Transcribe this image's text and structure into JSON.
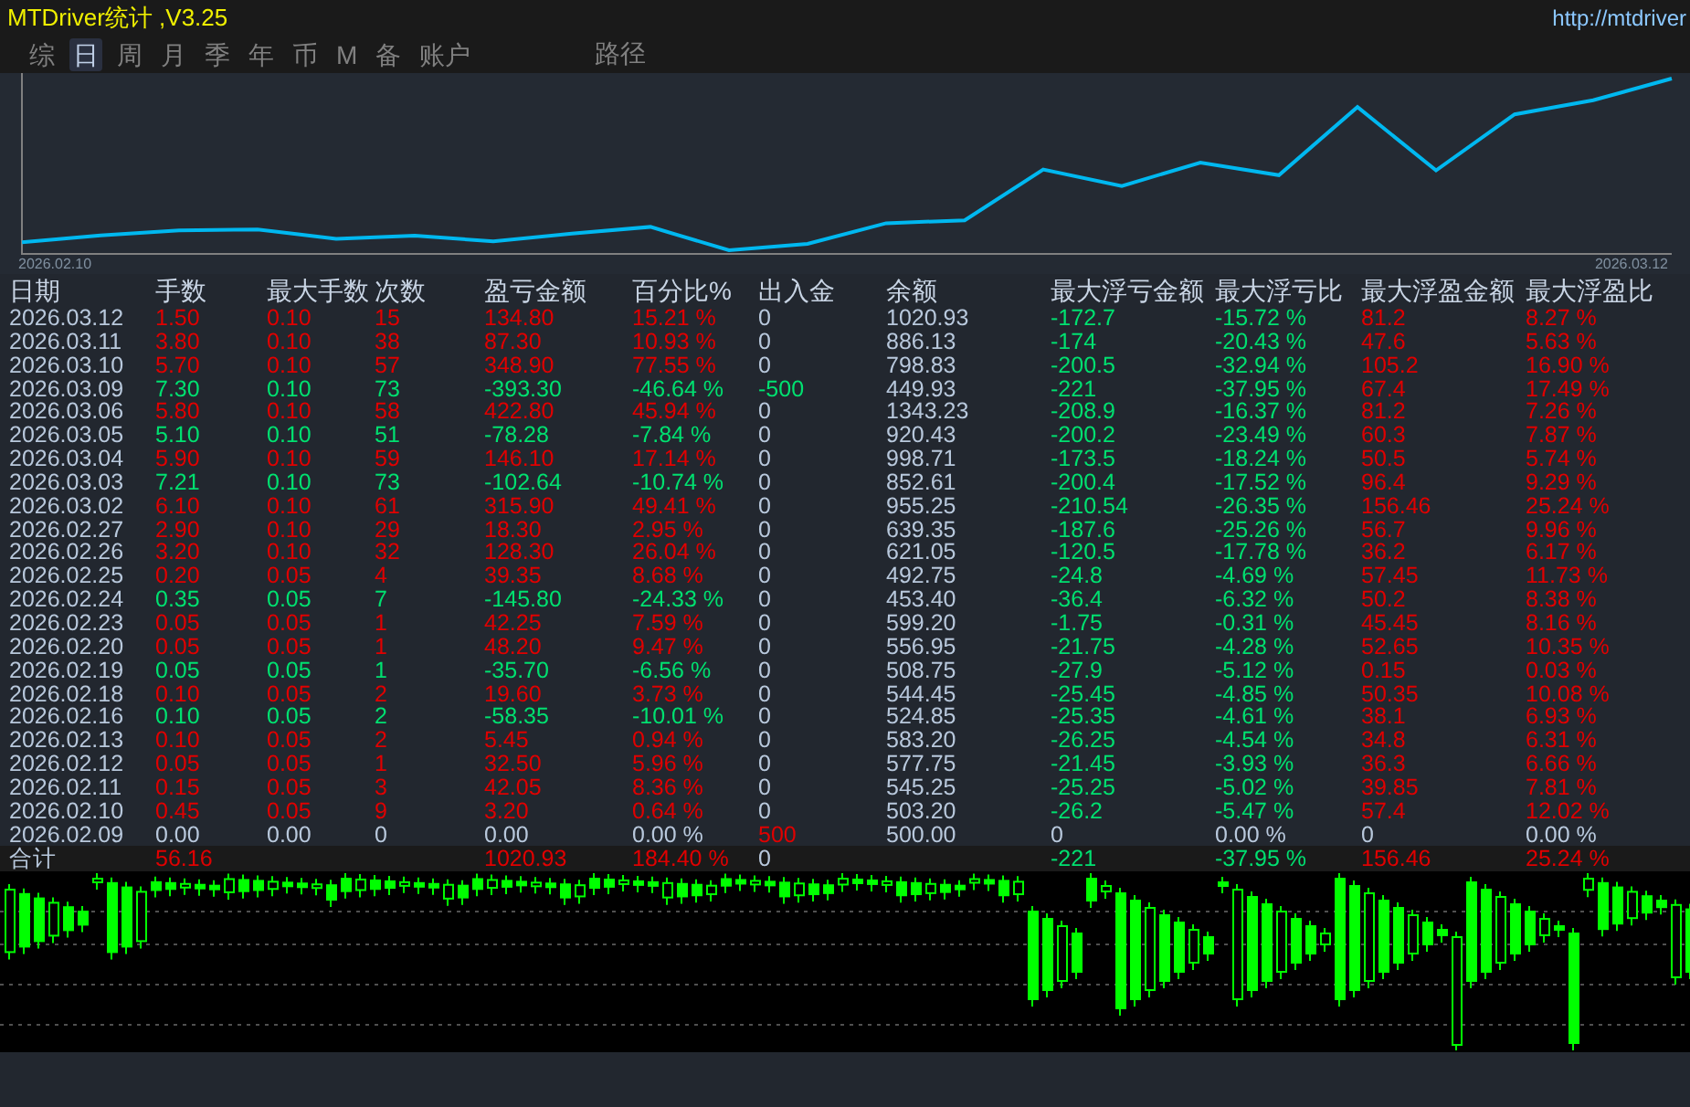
{
  "window": {
    "title": "MTDriver统计 ,V3.25",
    "link": "http://mtdriver"
  },
  "tabs": [
    {
      "label": "综",
      "selected": false
    },
    {
      "label": "日",
      "selected": true
    },
    {
      "label": "周",
      "selected": false
    },
    {
      "label": "月",
      "selected": false
    },
    {
      "label": "季",
      "selected": false
    },
    {
      "label": "年",
      "selected": false
    },
    {
      "label": "币",
      "selected": false
    },
    {
      "label": "M",
      "selected": false
    },
    {
      "label": "备",
      "selected": false
    },
    {
      "label": "账户",
      "selected": false
    }
  ],
  "tools": [
    {
      "label": "路径"
    }
  ],
  "balance_chart": {
    "start_label": "2026.02.10",
    "end_label": "2026.03.12"
  },
  "table": {
    "columns": [
      "日期",
      "手数",
      "最大手数",
      "次数",
      "盈亏金额",
      "百分比%",
      "出入金",
      "余额",
      "最大浮亏金额",
      "最大浮亏比",
      "最大浮盈金额",
      "最大浮盈比"
    ],
    "rows": [
      {
        "date": "2026.03.12",
        "trade": {
          "color": "#e00000",
          "lots": "1.50",
          "max_lots": "0.10",
          "count": "15",
          "pnl": "134.80",
          "pct": "15.21 %"
        },
        "flow": {
          "color": "#b8c8dc",
          "text": "0"
        },
        "balance": "1020.93",
        "float_loss": {
          "color": "#00e070",
          "amount": "-172.7",
          "pct": "-15.72 %"
        },
        "float_profit": {
          "color": "#e00000",
          "amount": "81.2",
          "pct": "8.27 %"
        }
      },
      {
        "date": "2026.03.11",
        "trade": {
          "color": "#e00000",
          "lots": "3.80",
          "max_lots": "0.10",
          "count": "38",
          "pnl": "87.30",
          "pct": "10.93 %"
        },
        "flow": {
          "color": "#b8c8dc",
          "text": "0"
        },
        "balance": "886.13",
        "float_loss": {
          "color": "#00e070",
          "amount": "-174",
          "pct": "-20.43 %"
        },
        "float_profit": {
          "color": "#e00000",
          "amount": "47.6",
          "pct": "5.63 %"
        }
      },
      {
        "date": "2026.03.10",
        "trade": {
          "color": "#e00000",
          "lots": "5.70",
          "max_lots": "0.10",
          "count": "57",
          "pnl": "348.90",
          "pct": "77.55 %"
        },
        "flow": {
          "color": "#b8c8dc",
          "text": "0"
        },
        "balance": "798.83",
        "float_loss": {
          "color": "#00e070",
          "amount": "-200.5",
          "pct": "-32.94 %"
        },
        "float_profit": {
          "color": "#e00000",
          "amount": "105.2",
          "pct": "16.90 %"
        }
      },
      {
        "date": "2026.03.09",
        "trade": {
          "color": "#00e070",
          "lots": "7.30",
          "max_lots": "0.10",
          "count": "73",
          "pnl": "-393.30",
          "pct": "-46.64 %"
        },
        "flow": {
          "color": "#00e070",
          "text": "-500"
        },
        "balance": "449.93",
        "float_loss": {
          "color": "#00e070",
          "amount": "-221",
          "pct": "-37.95 %"
        },
        "float_profit": {
          "color": "#e00000",
          "amount": "67.4",
          "pct": "17.49 %"
        }
      },
      {
        "date": "2026.03.06",
        "trade": {
          "color": "#e00000",
          "lots": "5.80",
          "max_lots": "0.10",
          "count": "58",
          "pnl": "422.80",
          "pct": "45.94 %"
        },
        "flow": {
          "color": "#b8c8dc",
          "text": "0"
        },
        "balance": "1343.23",
        "float_loss": {
          "color": "#00e070",
          "amount": "-208.9",
          "pct": "-16.37 %"
        },
        "float_profit": {
          "color": "#e00000",
          "amount": "81.2",
          "pct": "7.26 %"
        }
      },
      {
        "date": "2026.03.05",
        "trade": {
          "color": "#00e070",
          "lots": "5.10",
          "max_lots": "0.10",
          "count": "51",
          "pnl": "-78.28",
          "pct": "-7.84 %"
        },
        "flow": {
          "color": "#b8c8dc",
          "text": "0"
        },
        "balance": "920.43",
        "float_loss": {
          "color": "#00e070",
          "amount": "-200.2",
          "pct": "-23.49 %"
        },
        "float_profit": {
          "color": "#e00000",
          "amount": "60.3",
          "pct": "7.87 %"
        }
      },
      {
        "date": "2026.03.04",
        "trade": {
          "color": "#e00000",
          "lots": "5.90",
          "max_lots": "0.10",
          "count": "59",
          "pnl": "146.10",
          "pct": "17.14 %"
        },
        "flow": {
          "color": "#b8c8dc",
          "text": "0"
        },
        "balance": "998.71",
        "float_loss": {
          "color": "#00e070",
          "amount": "-173.5",
          "pct": "-18.24 %"
        },
        "float_profit": {
          "color": "#e00000",
          "amount": "50.5",
          "pct": "5.74 %"
        }
      },
      {
        "date": "2026.03.03",
        "trade": {
          "color": "#00e070",
          "lots": "7.21",
          "max_lots": "0.10",
          "count": "73",
          "pnl": "-102.64",
          "pct": "-10.74 %"
        },
        "flow": {
          "color": "#b8c8dc",
          "text": "0"
        },
        "balance": "852.61",
        "float_loss": {
          "color": "#00e070",
          "amount": "-200.4",
          "pct": "-17.52 %"
        },
        "float_profit": {
          "color": "#e00000",
          "amount": "96.4",
          "pct": "9.29 %"
        }
      },
      {
        "date": "2026.03.02",
        "trade": {
          "color": "#e00000",
          "lots": "6.10",
          "max_lots": "0.10",
          "count": "61",
          "pnl": "315.90",
          "pct": "49.41 %"
        },
        "flow": {
          "color": "#b8c8dc",
          "text": "0"
        },
        "balance": "955.25",
        "float_loss": {
          "color": "#00e070",
          "amount": "-210.54",
          "pct": "-26.35 %"
        },
        "float_profit": {
          "color": "#e00000",
          "amount": "156.46",
          "pct": "25.24 %"
        }
      },
      {
        "date": "2026.02.27",
        "trade": {
          "color": "#e00000",
          "lots": "2.90",
          "max_lots": "0.10",
          "count": "29",
          "pnl": "18.30",
          "pct": "2.95 %"
        },
        "flow": {
          "color": "#b8c8dc",
          "text": "0"
        },
        "balance": "639.35",
        "float_loss": {
          "color": "#00e070",
          "amount": "-187.6",
          "pct": "-25.26 %"
        },
        "float_profit": {
          "color": "#e00000",
          "amount": "56.7",
          "pct": "9.96 %"
        }
      },
      {
        "date": "2026.02.26",
        "trade": {
          "color": "#e00000",
          "lots": "3.20",
          "max_lots": "0.10",
          "count": "32",
          "pnl": "128.30",
          "pct": "26.04 %"
        },
        "flow": {
          "color": "#b8c8dc",
          "text": "0"
        },
        "balance": "621.05",
        "float_loss": {
          "color": "#00e070",
          "amount": "-120.5",
          "pct": "-17.78 %"
        },
        "float_profit": {
          "color": "#e00000",
          "amount": "36.2",
          "pct": "6.17 %"
        }
      },
      {
        "date": "2026.02.25",
        "trade": {
          "color": "#e00000",
          "lots": "0.20",
          "max_lots": "0.05",
          "count": "4",
          "pnl": "39.35",
          "pct": "8.68 %"
        },
        "flow": {
          "color": "#b8c8dc",
          "text": "0"
        },
        "balance": "492.75",
        "float_loss": {
          "color": "#00e070",
          "amount": "-24.8",
          "pct": "-4.69 %"
        },
        "float_profit": {
          "color": "#e00000",
          "amount": "57.45",
          "pct": "11.73 %"
        }
      },
      {
        "date": "2026.02.24",
        "trade": {
          "color": "#00e070",
          "lots": "0.35",
          "max_lots": "0.05",
          "count": "7",
          "pnl": "-145.80",
          "pct": "-24.33 %"
        },
        "flow": {
          "color": "#b8c8dc",
          "text": "0"
        },
        "balance": "453.40",
        "float_loss": {
          "color": "#00e070",
          "amount": "-36.4",
          "pct": "-6.32 %"
        },
        "float_profit": {
          "color": "#e00000",
          "amount": "50.2",
          "pct": "8.38 %"
        }
      },
      {
        "date": "2026.02.23",
        "trade": {
          "color": "#e00000",
          "lots": "0.05",
          "max_lots": "0.05",
          "count": "1",
          "pnl": "42.25",
          "pct": "7.59 %"
        },
        "flow": {
          "color": "#b8c8dc",
          "text": "0"
        },
        "balance": "599.20",
        "float_loss": {
          "color": "#00e070",
          "amount": "-1.75",
          "pct": "-0.31 %"
        },
        "float_profit": {
          "color": "#e00000",
          "amount": "45.45",
          "pct": "8.16 %"
        }
      },
      {
        "date": "2026.02.20",
        "trade": {
          "color": "#e00000",
          "lots": "0.05",
          "max_lots": "0.05",
          "count": "1",
          "pnl": "48.20",
          "pct": "9.47 %"
        },
        "flow": {
          "color": "#b8c8dc",
          "text": "0"
        },
        "balance": "556.95",
        "float_loss": {
          "color": "#00e070",
          "amount": "-21.75",
          "pct": "-4.28 %"
        },
        "float_profit": {
          "color": "#e00000",
          "amount": "52.65",
          "pct": "10.35 %"
        }
      },
      {
        "date": "2026.02.19",
        "trade": {
          "color": "#00e070",
          "lots": "0.05",
          "max_lots": "0.05",
          "count": "1",
          "pnl": "-35.70",
          "pct": "-6.56 %"
        },
        "flow": {
          "color": "#b8c8dc",
          "text": "0"
        },
        "balance": "508.75",
        "float_loss": {
          "color": "#00e070",
          "amount": "-27.9",
          "pct": "-5.12 %"
        },
        "float_profit": {
          "color": "#e00000",
          "amount": "0.15",
          "pct": "0.03 %"
        }
      },
      {
        "date": "2026.02.18",
        "trade": {
          "color": "#e00000",
          "lots": "0.10",
          "max_lots": "0.05",
          "count": "2",
          "pnl": "19.60",
          "pct": "3.73 %"
        },
        "flow": {
          "color": "#b8c8dc",
          "text": "0"
        },
        "balance": "544.45",
        "float_loss": {
          "color": "#00e070",
          "amount": "-25.45",
          "pct": "-4.85 %"
        },
        "float_profit": {
          "color": "#e00000",
          "amount": "50.35",
          "pct": "10.08 %"
        }
      },
      {
        "date": "2026.02.16",
        "trade": {
          "color": "#00e070",
          "lots": "0.10",
          "max_lots": "0.05",
          "count": "2",
          "pnl": "-58.35",
          "pct": "-10.01 %"
        },
        "flow": {
          "color": "#b8c8dc",
          "text": "0"
        },
        "balance": "524.85",
        "float_loss": {
          "color": "#00e070",
          "amount": "-25.35",
          "pct": "-4.61 %"
        },
        "float_profit": {
          "color": "#e00000",
          "amount": "38.1",
          "pct": "6.93 %"
        }
      },
      {
        "date": "2026.02.13",
        "trade": {
          "color": "#e00000",
          "lots": "0.10",
          "max_lots": "0.05",
          "count": "2",
          "pnl": "5.45",
          "pct": "0.94 %"
        },
        "flow": {
          "color": "#b8c8dc",
          "text": "0"
        },
        "balance": "583.20",
        "float_loss": {
          "color": "#00e070",
          "amount": "-26.25",
          "pct": "-4.54 %"
        },
        "float_profit": {
          "color": "#e00000",
          "amount": "34.8",
          "pct": "6.31 %"
        }
      },
      {
        "date": "2026.02.12",
        "trade": {
          "color": "#e00000",
          "lots": "0.05",
          "max_lots": "0.05",
          "count": "1",
          "pnl": "32.50",
          "pct": "5.96 %"
        },
        "flow": {
          "color": "#b8c8dc",
          "text": "0"
        },
        "balance": "577.75",
        "float_loss": {
          "color": "#00e070",
          "amount": "-21.45",
          "pct": "-3.93 %"
        },
        "float_profit": {
          "color": "#e00000",
          "amount": "36.3",
          "pct": "6.66 %"
        }
      },
      {
        "date": "2026.02.11",
        "trade": {
          "color": "#e00000",
          "lots": "0.15",
          "max_lots": "0.05",
          "count": "3",
          "pnl": "42.05",
          "pct": "8.36 %"
        },
        "flow": {
          "color": "#b8c8dc",
          "text": "0"
        },
        "balance": "545.25",
        "float_loss": {
          "color": "#00e070",
          "amount": "-25.25",
          "pct": "-5.02 %"
        },
        "float_profit": {
          "color": "#e00000",
          "amount": "39.85",
          "pct": "7.81 %"
        }
      },
      {
        "date": "2026.02.10",
        "trade": {
          "color": "#e00000",
          "lots": "0.45",
          "max_lots": "0.05",
          "count": "9",
          "pnl": "3.20",
          "pct": "0.64 %"
        },
        "flow": {
          "color": "#b8c8dc",
          "text": "0"
        },
        "balance": "503.20",
        "float_loss": {
          "color": "#00e070",
          "amount": "-26.2",
          "pct": "-5.47 %"
        },
        "float_profit": {
          "color": "#e00000",
          "amount": "57.4",
          "pct": "12.02 %"
        }
      },
      {
        "date": "2026.02.09",
        "trade": {
          "color": "#b8c8dc",
          "lots": "0.00",
          "max_lots": "0.00",
          "count": "0",
          "pnl": "0.00",
          "pct": "0.00 %"
        },
        "flow": {
          "color": "#e00000",
          "text": "500"
        },
        "balance": "500.00",
        "float_loss": {
          "color": "#b8c8dc",
          "amount": "0",
          "pct": "0.00 %"
        },
        "float_profit": {
          "color": "#b8c8dc",
          "amount": "0",
          "pct": "0.00 %"
        }
      }
    ],
    "total": {
      "label": "合计",
      "trade": {
        "color": "#e00000",
        "lots": "56.16",
        "pnl": "1020.93",
        "pct": "184.40 %"
      },
      "flow": {
        "color": "#b8c8dc",
        "text": "0"
      },
      "float_loss": {
        "color": "#00e070",
        "amount": "-221",
        "pct": "-37.95 %"
      },
      "float_profit": {
        "color": "#e00000",
        "amount": "156.46",
        "pct": "25.24 %"
      }
    }
  }
}
